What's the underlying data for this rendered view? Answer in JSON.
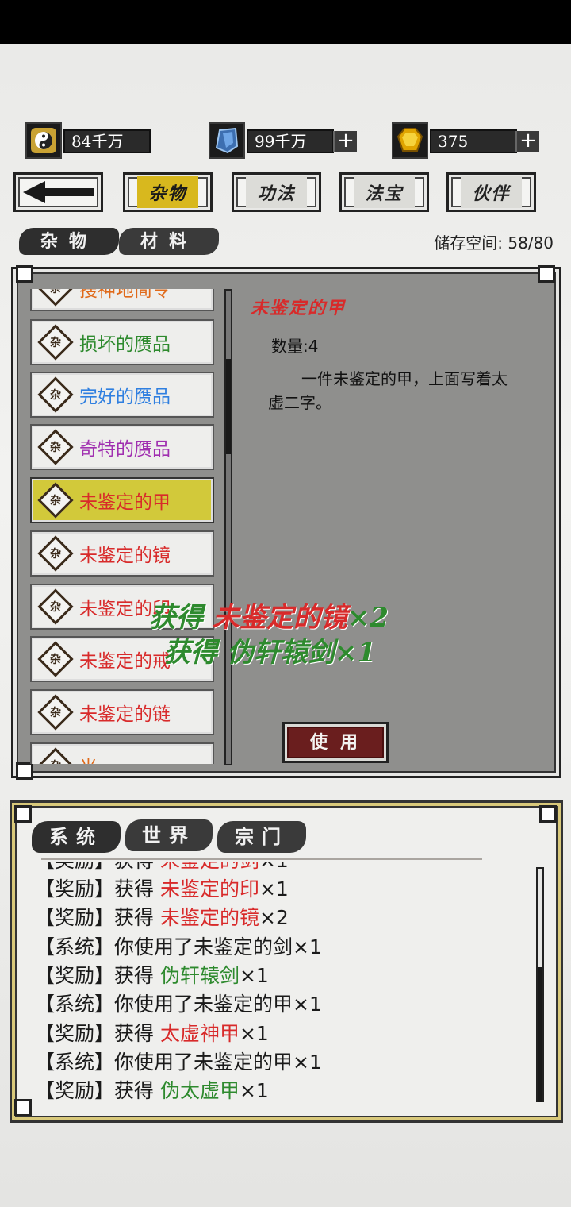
{
  "resources": [
    {
      "icon": "taiji-coin-icon",
      "value": "84千万",
      "has_plus": false
    },
    {
      "icon": "blue-crystal-icon",
      "value": "99千万",
      "has_plus": true
    },
    {
      "icon": "gold-gem-icon",
      "value": "375",
      "has_plus": true
    }
  ],
  "nav": {
    "back_icon": "back-arrow-icon",
    "tabs": [
      {
        "label": "杂物",
        "active": true
      },
      {
        "label": "功法",
        "active": false
      },
      {
        "label": "法宝",
        "active": false
      },
      {
        "label": "伙伴",
        "active": false
      }
    ]
  },
  "subtabs": [
    {
      "label": "杂物"
    },
    {
      "label": "材料"
    }
  ],
  "storage": "储存空间: 58/80",
  "items": [
    {
      "name": "搜神地简令",
      "color": "orange",
      "partial": "top"
    },
    {
      "name": "损坏的赝品",
      "color": "green"
    },
    {
      "name": "完好的赝品",
      "color": "blue"
    },
    {
      "name": "奇特的赝品",
      "color": "purple"
    },
    {
      "name": "未鉴定的甲",
      "color": "red",
      "selected": true
    },
    {
      "name": "未鉴定的镜",
      "color": "red"
    },
    {
      "name": "未鉴定的印",
      "color": "red"
    },
    {
      "name": "未鉴定的戒",
      "color": "red"
    },
    {
      "name": "未鉴定的链",
      "color": "red"
    },
    {
      "name": "光",
      "color": "orange",
      "partial": "bottom"
    }
  ],
  "item_badge": "杂",
  "detail": {
    "title": "未鉴定的甲",
    "quantity": "数量:4",
    "description": "一件未鉴定的甲，上面写着太虚二字。",
    "use_label": "使用"
  },
  "toasts": [
    {
      "prefix": "获得 ",
      "item": "未鉴定的镜",
      "count": "×2"
    },
    {
      "prefix": "获得 ",
      "item": "伪轩辕剑",
      "count": "×1"
    }
  ],
  "channels": [
    {
      "label": "系统"
    },
    {
      "label": "世界"
    },
    {
      "label": "宗门"
    }
  ],
  "log": [
    {
      "tag": "【奖励】",
      "text": "获得 ",
      "item": "未鉴定的剑",
      "item_color": "red",
      "suffix": "×1",
      "partial": true
    },
    {
      "tag": "【奖励】",
      "text": "获得 ",
      "item": "未鉴定的印",
      "item_color": "red",
      "suffix": "×1"
    },
    {
      "tag": "【奖励】",
      "text": "获得 ",
      "item": "未鉴定的镜",
      "item_color": "red",
      "suffix": "×2"
    },
    {
      "tag": "【系统】",
      "text": "你使用了未鉴定的剑×1",
      "item": "",
      "item_color": "",
      "suffix": ""
    },
    {
      "tag": "【奖励】",
      "text": "获得 ",
      "item": "伪轩辕剑",
      "item_color": "green",
      "suffix": "×1"
    },
    {
      "tag": "【系统】",
      "text": "你使用了未鉴定的甲×1",
      "item": "",
      "item_color": "",
      "suffix": ""
    },
    {
      "tag": "【奖励】",
      "text": "获得 ",
      "item": "太虚神甲",
      "item_color": "red",
      "suffix": "×1"
    },
    {
      "tag": "【系统】",
      "text": "你使用了未鉴定的甲×1",
      "item": "",
      "item_color": "",
      "suffix": ""
    },
    {
      "tag": "【奖励】",
      "text": "获得 ",
      "item": "伪太虚甲",
      "item_color": "green",
      "suffix": "×1"
    }
  ],
  "colors": {
    "red": "#d82a2a",
    "green": "#2e8a2e",
    "blue": "#2f7fe0",
    "purple": "#a02fb0",
    "orange": "#e06a1a",
    "gold": "#d8b81e"
  }
}
